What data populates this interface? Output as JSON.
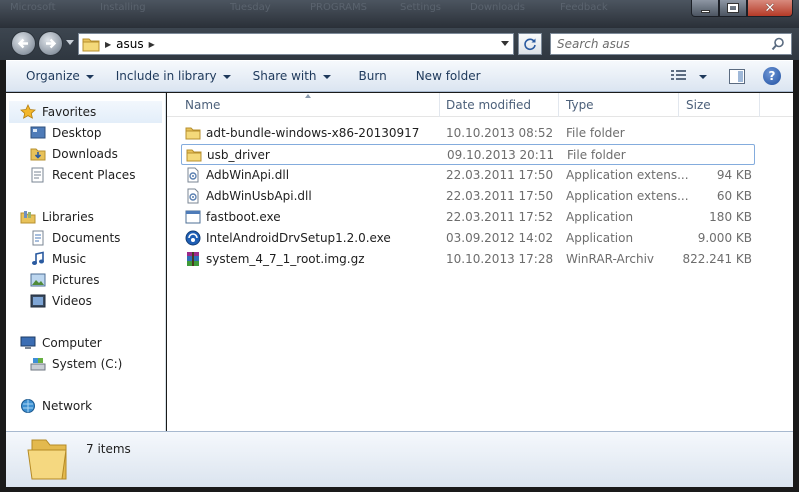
{
  "window": {
    "ghost_titles": [
      "Microsoft",
      "Installing",
      "Tuesday",
      "PROGRAMS",
      "Settings",
      "Downloads",
      "Feedback"
    ]
  },
  "address": {
    "breadcrumb": [
      "asus"
    ],
    "search_placeholder": "Search asus"
  },
  "toolbar": {
    "items": [
      {
        "label": "Organize",
        "has_dropdown": true
      },
      {
        "label": "Include in library",
        "has_dropdown": true
      },
      {
        "label": "Share with",
        "has_dropdown": true
      },
      {
        "label": "Burn",
        "has_dropdown": false
      },
      {
        "label": "New folder",
        "has_dropdown": false
      }
    ],
    "help_label": "?"
  },
  "sidebar": {
    "favorites": {
      "label": "Favorites",
      "items": [
        "Desktop",
        "Downloads",
        "Recent Places"
      ]
    },
    "libraries": {
      "label": "Libraries",
      "items": [
        "Documents",
        "Music",
        "Pictures",
        "Videos"
      ]
    },
    "computer": {
      "label": "Computer",
      "items": [
        "System (C:)"
      ]
    },
    "network": {
      "label": "Network"
    }
  },
  "columns": [
    "Name",
    "Date modified",
    "Type",
    "Size"
  ],
  "files": [
    {
      "name": "adt-bundle-windows-x86-20130917",
      "date": "10.10.2013 08:52",
      "type": "File folder",
      "size": "",
      "icon": "folder-icon"
    },
    {
      "name": "usb_driver",
      "date": "09.10.2013 20:11",
      "type": "File folder",
      "size": "",
      "icon": "folder-icon",
      "selected": true
    },
    {
      "name": "AdbWinApi.dll",
      "date": "22.03.2011 17:50",
      "type": "Application extens...",
      "size": "94 KB",
      "icon": "dll-icon"
    },
    {
      "name": "AdbWinUsbApi.dll",
      "date": "22.03.2011 17:50",
      "type": "Application extens...",
      "size": "60 KB",
      "icon": "dll-icon"
    },
    {
      "name": "fastboot.exe",
      "date": "22.03.2011 17:52",
      "type": "Application",
      "size": "180 KB",
      "icon": "exe-icon"
    },
    {
      "name": "IntelAndroidDrvSetup1.2.0.exe",
      "date": "03.09.2012 14:02",
      "type": "Application",
      "size": "9.000 KB",
      "icon": "installer-icon"
    },
    {
      "name": "system_4_7_1_root.img.gz",
      "date": "10.10.2013 17:28",
      "type": "WinRAR-Archiv",
      "size": "822.241 KB",
      "icon": "winrar-icon"
    }
  ],
  "details": {
    "item_count": "7 items"
  },
  "colors": {
    "toolbar_text": "#1e395b",
    "selection_border": "#84acdd",
    "column_header": "#4c607a"
  }
}
